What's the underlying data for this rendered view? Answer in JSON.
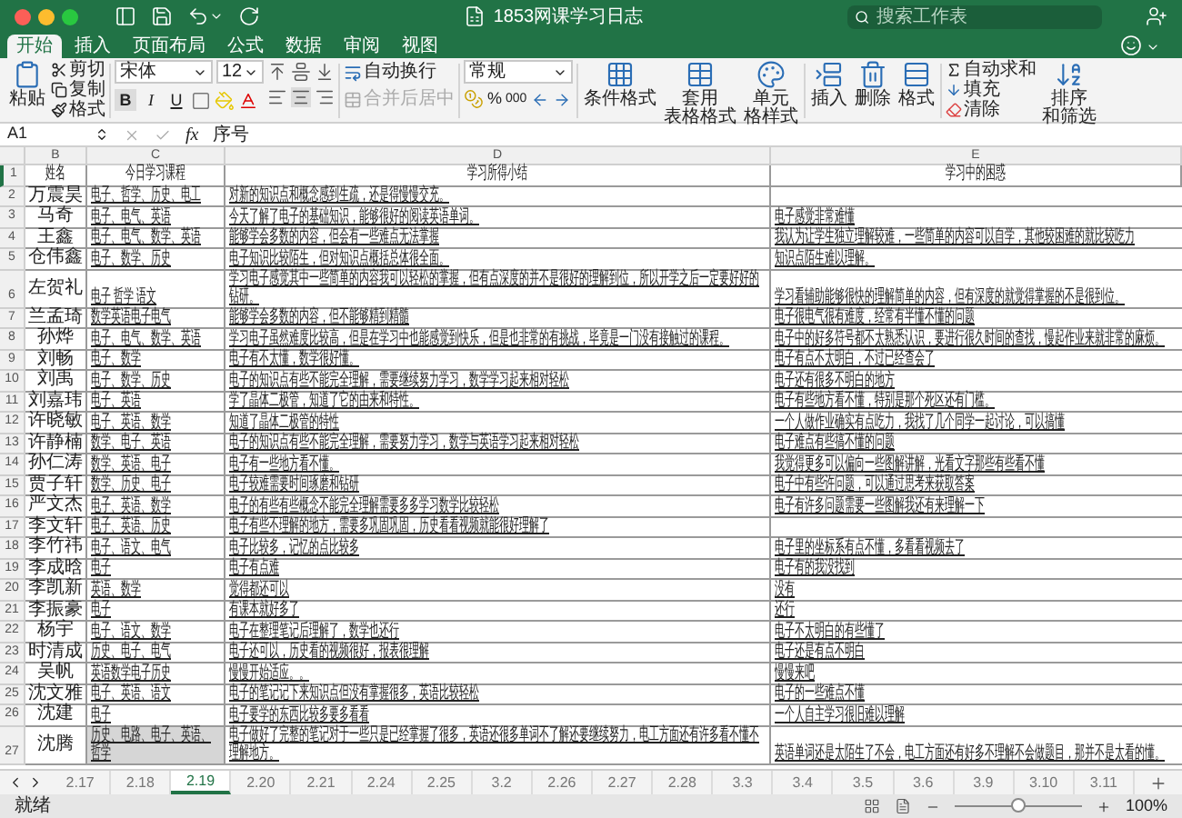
{
  "window": {
    "title": "1853网课学习日志",
    "search": {
      "placeholder": "搜索工作表"
    }
  },
  "ribbon_tabs": [
    {
      "label": "开始",
      "selected": true
    },
    {
      "label": "插入",
      "selected": false
    },
    {
      "label": "页面布局",
      "selected": false
    },
    {
      "label": "公式",
      "selected": false
    },
    {
      "label": "数据",
      "selected": false
    },
    {
      "label": "审阅",
      "selected": false
    },
    {
      "label": "视图",
      "selected": false
    }
  ],
  "ribbon": {
    "paste": "粘贴",
    "cut": "剪切",
    "copy": "复制",
    "format_painter": "格式",
    "font": {
      "name": "宋体",
      "size": "12",
      "bold": "B",
      "italic": "I",
      "underline": "U"
    },
    "wrap_text": {
      "label": "自动换行",
      "disabled": false
    },
    "merge_center": {
      "label": "合并后居中",
      "disabled": true
    },
    "number": {
      "format": "常规",
      "percent": "%",
      "thousands": "000"
    },
    "styles": [
      {
        "lines": [
          "条件格式"
        ]
      },
      {
        "lines": [
          "套用",
          "表格格式"
        ]
      },
      {
        "lines": [
          "单元",
          "格样式"
        ]
      }
    ],
    "cells": [
      "插入",
      "删除",
      "格式"
    ],
    "autosum": "自动求和",
    "fill": "填充",
    "clear": "清除",
    "sort": {
      "lines": [
        "排序",
        "和筛选"
      ]
    }
  },
  "formula_bar": {
    "cell": "A1",
    "fx": "fx",
    "value": "序号"
  },
  "columns": [
    "B",
    "C",
    "D",
    "E"
  ],
  "header": {
    "number": "1",
    "cells": [
      "姓名",
      "今日学习课程",
      "学习所得小结",
      "学习中的困惑"
    ]
  },
  "rows": [
    {
      "number": "2",
      "name": "万震昊",
      "courses": "电子、哲学、历史、电工",
      "summary": "对新的知识点和概念感到生疏，还是得慢慢交充。",
      "highlight": false
    },
    {
      "number": "3",
      "name": "马奇",
      "courses": "电子、电气、英语",
      "summary": "今天了解了电子的基础知识，能够很好的阅读英语单词。",
      "confusion": "电子感觉非常难懂",
      "highlight": false
    },
    {
      "number": "4",
      "name": "王鑫",
      "courses": "电子、电气、数学、英语",
      "summary": "能够学会多数的内容，但会有一些难点无法掌握",
      "confusion": "我认为让学生独立理解较难，一些简单的内容可以自学，其他较困难的就比较吃力",
      "highlight": false
    },
    {
      "number": "5",
      "name": "仓伟鑫",
      "courses": "电子、数学、历史",
      "summary": "电子知识比较陌生，但对知识点概括总体很全面。",
      "confusion": "知识点陌生难以理解。",
      "highlight": false
    },
    {
      "number": "6",
      "name": "左贺礼",
      "courses": "电子 哲学 语文",
      "summary": "学习电子感觉其中一些简单的内容我可以轻松的掌握，但有点深度的并不是很好的理解到位，所以开学之后一定要好好的钻研。",
      "confusion": "学习看辅助能够很快的理解简单的内容，但有深度的就觉得掌握的不是很到位。",
      "highlight": false
    },
    {
      "number": "7",
      "name": "兰孟琦",
      "courses": "数学英语电子电气",
      "summary": "能够学会多数的内容，但不能够精到精髓",
      "confusion": "电子很电气很有难度，经常有半懂不懂的问题",
      "highlight": false
    },
    {
      "number": "8",
      "name": "孙烨",
      "courses": "电子、电气、数学、英语",
      "summary": "学习电子虽然难度比较高，但是在学习中也能感觉到快乐，但是也非常的有挑战，毕竟是一门没有接触过的课程。",
      "confusion": "电子中的好多符号都不太熟悉认识，要进行很久时间的查找，慢起作业来就非常的麻烦。",
      "highlight": false
    },
    {
      "number": "9",
      "name": "刘畅",
      "courses": "电子、数学",
      "summary": "电子有不太懂，数学很好懂。",
      "confusion": "电子有点不太明白，不过已经查会了",
      "highlight": false
    },
    {
      "number": "10",
      "name": "刘禹",
      "courses": "电子、数学、历史",
      "summary": "电子的知识点有些不能完全理解，需要继续努力学习，数学学习起来相对轻松",
      "confusion": "电子还有很多不明白的地方",
      "highlight": false
    },
    {
      "number": "11",
      "name": "刘嘉玮",
      "courses": "电子、英语",
      "summary": "学了晶体二极管，知道了它的由来和特性。",
      "confusion": "电子有些地方看不懂，特别是那个死区还有门槛。",
      "highlight": false
    },
    {
      "number": "12",
      "name": "许晓敏",
      "courses": "电子、英语、数学",
      "summary": "知道了晶体二极管的特性",
      "confusion": "一个人做作业确实有点吃力，我找了几个同学一起讨论，可以搞懂",
      "highlight": false
    },
    {
      "number": "13",
      "name": "许静楠",
      "courses": "数学、电子、英语",
      "summary": "电子的知识点有些不能完全理解，需要努力学习，数学与英语学习起来相对轻松",
      "confusion": "电子难点有些搞不懂的问题",
      "highlight": false
    },
    {
      "number": "14",
      "name": "孙仁涛",
      "courses": "数学、英语、电子",
      "summary": "电子有一些地方看不懂。",
      "confusion": "我觉得更多可以偏向一些图解讲解，光看文字那些有些看不懂",
      "highlight": false
    },
    {
      "number": "15",
      "name": "贾子轩",
      "courses": "数学、历史、电子",
      "summary": "电子较难需要时间琢磨和钻研",
      "confusion": "电子中有些许问题，可以通过思考来获取答案",
      "highlight": false
    },
    {
      "number": "16",
      "name": "严文杰",
      "courses": "电子、英语、数学",
      "summary": "电子的有些有些概念不能完全理解需要多多学习数学比较轻松",
      "confusion": "电子有许多问题需要一些图解我还有来理解一下",
      "highlight": false
    },
    {
      "number": "17",
      "name": "李文轩",
      "courses": "电子、英语、历史",
      "summary": "电子有些不理解的地方，需要多巩固巩固，历史看看视频就能很好理解了",
      "highlight": false
    },
    {
      "number": "18",
      "name": "李竹祎",
      "courses": "电子、语文、电气",
      "summary": "电子比较多，记忆的点比较多",
      "confusion": "电子里的坐标系有点不懂，多看看视频去了",
      "highlight": false
    },
    {
      "number": "19",
      "name": "李成晗",
      "courses": "电子",
      "summary": "电子有点难",
      "confusion": "电子有的我没找到",
      "highlight": false
    },
    {
      "number": "20",
      "name": "李凯新",
      "courses": "英语、数学",
      "summary": "觉得都还可以",
      "confusion": "没有",
      "highlight": false
    },
    {
      "number": "21",
      "name": "李振豪",
      "courses": "电子",
      "summary": "有课本就好多了",
      "confusion": "还行",
      "highlight": false
    },
    {
      "number": "22",
      "name": "杨宇",
      "courses": "电子、语文、数学",
      "summary": "电子在整理笔记后理解了，数学也还行",
      "confusion": "电子不太明白的有些懂了",
      "highlight": false
    },
    {
      "number": "23",
      "name": "时清成",
      "courses": "历史、电子、电气",
      "summary": "电子还可以，历史看的视频很好，报表很理解",
      "confusion": "电子还是有点不明白",
      "highlight": false
    },
    {
      "number": "24",
      "name": "吴帆",
      "courses": "英语数学电子历史",
      "summary": "慢慢开始适应。。",
      "confusion": "慢慢来吧",
      "highlight": false
    },
    {
      "number": "25",
      "name": "沈文雅",
      "courses": "电子、英语、语文",
      "summary": "电子的笔记记下来知识点但没有掌握很多，英语比较轻松",
      "confusion": "电子的一些难点不懂",
      "highlight": false
    },
    {
      "number": "26",
      "name": "沈建",
      "courses": "电子",
      "summary": "电子要学的东西比较多要多看看",
      "confusion": "一个人自主学习很旧难以理解",
      "highlight": false
    },
    {
      "number": "27",
      "name": "沈腾",
      "courses": "历史、电路、电子、英语、哲学",
      "summary": "电子做好了完整的笔记对于一些只是已经掌握了很多，英语还很多单词不了解还要继续努力，电工方面还有许多看不懂不理解地方。",
      "confusion": "英语单词还是太陌生了不会，电工方面还有好多不理解不会做题目，那并不是太看的懂。",
      "highlight": true
    }
  ],
  "sheet_tabs": [
    {
      "label": "2.17",
      "selected": false
    },
    {
      "label": "2.18",
      "selected": false
    },
    {
      "label": "2.19",
      "selected": true
    },
    {
      "label": "2.20",
      "selected": false
    },
    {
      "label": "2.21",
      "selected": false
    },
    {
      "label": "2.24",
      "selected": false
    },
    {
      "label": "2.25",
      "selected": false
    },
    {
      "label": "3.2",
      "selected": false
    },
    {
      "label": "2.26",
      "selected": false
    },
    {
      "label": "2.27",
      "selected": false
    },
    {
      "label": "2.28",
      "selected": false
    },
    {
      "label": "3.3",
      "selected": false
    },
    {
      "label": "3.4",
      "selected": false
    },
    {
      "label": "3.5",
      "selected": false
    },
    {
      "label": "3.6",
      "selected": false
    },
    {
      "label": "3.9",
      "selected": false
    },
    {
      "label": "3.10",
      "selected": false
    },
    {
      "label": "3.11",
      "selected": false
    }
  ],
  "status_bar": {
    "text": "就绪",
    "zoom": {
      "level": 0.5,
      "reading": "100%"
    }
  }
}
